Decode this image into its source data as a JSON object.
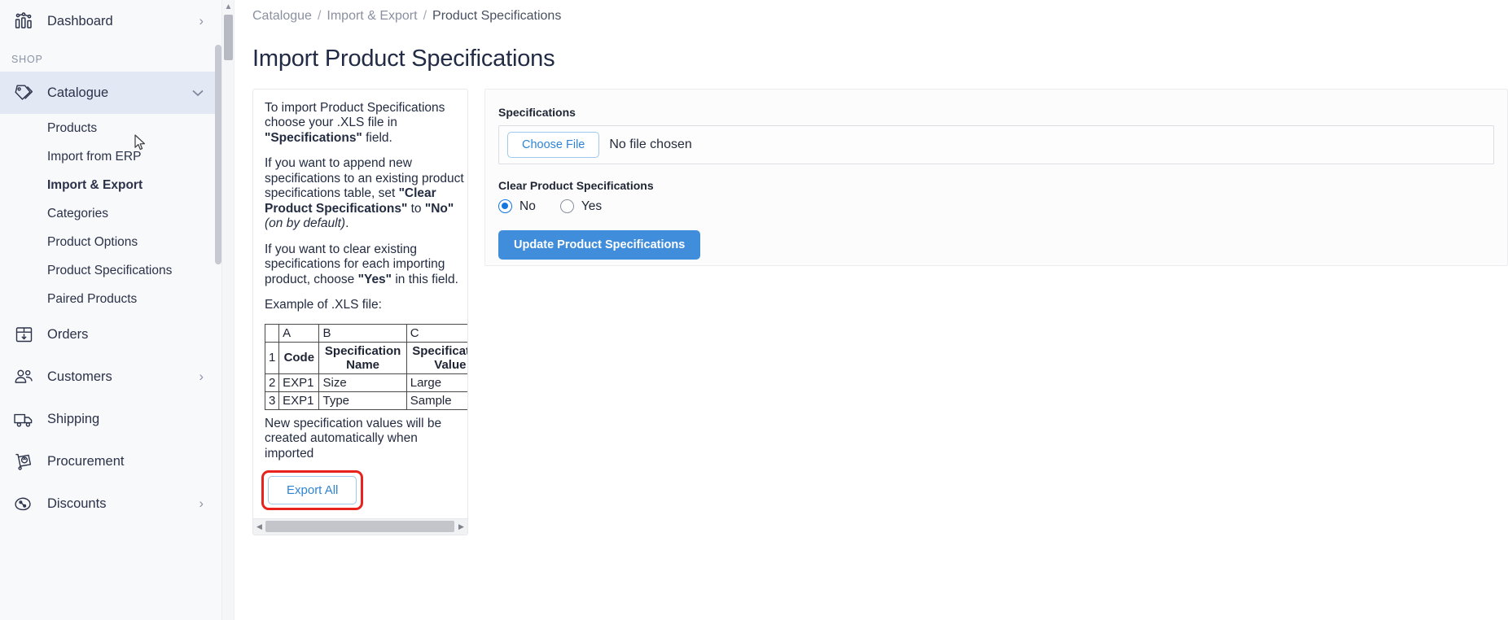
{
  "sidebar": {
    "top_item": {
      "label": "Dashboard",
      "icon": "dashboard-chart-icon",
      "chevron": "›"
    },
    "section_label": "SHOP",
    "groups": [
      {
        "label": "Catalogue",
        "icon": "tags-icon",
        "chevron": "⌄",
        "expanded": true,
        "children": [
          {
            "label": "Products",
            "current": false
          },
          {
            "label": "Import from ERP",
            "current": false
          },
          {
            "label": "Import & Export",
            "current": true
          },
          {
            "label": "Categories",
            "current": false
          },
          {
            "label": "Product Options",
            "current": false
          },
          {
            "label": "Product Specifications",
            "current": false
          },
          {
            "label": "Paired Products",
            "current": false
          }
        ]
      }
    ],
    "items": [
      {
        "label": "Orders",
        "icon": "box-arrow-down-icon",
        "chevron": ""
      },
      {
        "label": "Customers",
        "icon": "users-icon",
        "chevron": "›"
      },
      {
        "label": "Shipping",
        "icon": "truck-icon",
        "chevron": ""
      },
      {
        "label": "Procurement",
        "icon": "cart-refresh-icon",
        "chevron": ""
      },
      {
        "label": "Discounts",
        "icon": "percent-tag-icon",
        "chevron": "›"
      }
    ]
  },
  "breadcrumb": {
    "items": [
      "Catalogue",
      "Import & Export",
      "Product Specifications"
    ],
    "separator": "/"
  },
  "page": {
    "title": "Import Product Specifications"
  },
  "info_panel": {
    "p1_pre": "To import Product Specifications choose your .XLS file in ",
    "p1_bold": "\"Specifications\"",
    "p1_post": " field.",
    "p2_pre": "If you want to append new specifications to an existing product specifications table, set ",
    "p2_bold1": "\"Clear Product Specifications\"",
    "p2_mid": " to ",
    "p2_bold2": "\"No\"",
    "p2_italic": " (on by default)",
    "p2_post": ".",
    "p3_pre": "If you want to clear existing specifications for each importing product, choose ",
    "p3_bold": "\"Yes\"",
    "p3_post": " in this field.",
    "example_label": "Example of .XLS file:",
    "note": "New specification values will be created automatically when imported",
    "export_button": "Export All",
    "scroll_left_arrow": "◀",
    "scroll_right_arrow": "▶"
  },
  "xls_example": {
    "column_headers": [
      "",
      "A",
      "B",
      "C"
    ],
    "rows": [
      {
        "index": "1",
        "cells": [
          "Code",
          "Specification Name",
          "Specification Value"
        ],
        "bold": true
      },
      {
        "index": "2",
        "cells": [
          "EXP1",
          "Size",
          "Large"
        ],
        "bold": false
      },
      {
        "index": "3",
        "cells": [
          "EXP1",
          "Type",
          "Sample"
        ],
        "bold": false
      }
    ]
  },
  "form": {
    "specifications_label": "Specifications",
    "choose_file_button": "Choose File",
    "file_status": "No file chosen",
    "clear_label": "Clear Product Specifications",
    "radio_options": [
      {
        "label": "No",
        "selected": true
      },
      {
        "label": "Yes",
        "selected": false
      }
    ],
    "submit_button": "Update Product Specifications"
  },
  "colors": {
    "primary": "#3f8ddb",
    "link": "#2f84d4",
    "highlight": "#e8221c",
    "sidebar_active": "#e2e9f5"
  }
}
